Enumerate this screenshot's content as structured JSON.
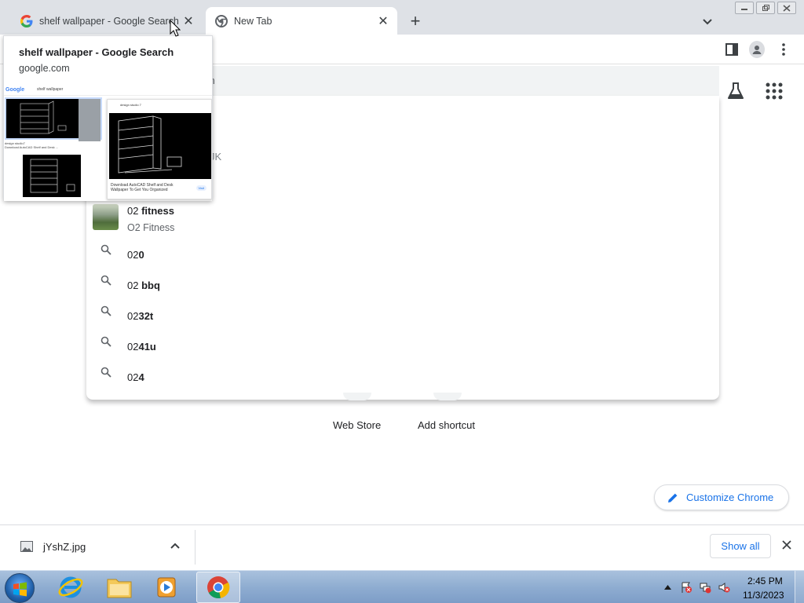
{
  "browser": {
    "tabs": [
      {
        "title": "shelf wallpaper - Google Search",
        "active": false,
        "favicon": "google-g-icon"
      },
      {
        "title": "New Tab",
        "active": true,
        "favicon": "chrome-icon"
      }
    ],
    "new_tab_glyph": "+",
    "tab_close_glyph": "✕"
  },
  "hover_card": {
    "title": "shelf wallpaper - Google Search",
    "domain": "google.com",
    "preview": {
      "logo": "Google",
      "query": "shelf wallpaper",
      "caption_line1": "design studio7",
      "caption_line2": "Download AutoCAD Shelf and Desk ...",
      "panel_source": "design studio 7",
      "panel_text": "Download AutoCAD Shelf and Desk Wallpaper To Get You Organized",
      "panel_visit": "Visit"
    }
  },
  "omnibox": {
    "placeholder_partial": "ch",
    "partial_text_uk": "JK"
  },
  "suggestions": [
    {
      "type": "entity",
      "prefix": "02 ",
      "bold": "fitness",
      "subtitle": "O2 Fitness",
      "icon": "thumbnail"
    },
    {
      "type": "search",
      "prefix": "02",
      "bold": "0",
      "icon": "search-icon"
    },
    {
      "type": "search",
      "prefix": "02 ",
      "bold": "bbq",
      "icon": "search-icon"
    },
    {
      "type": "search",
      "prefix": "02",
      "bold": "32t",
      "icon": "search-icon"
    },
    {
      "type": "search",
      "prefix": "02",
      "bold": "41u",
      "icon": "search-icon"
    },
    {
      "type": "search",
      "prefix": "02",
      "bold": "4",
      "icon": "search-icon"
    }
  ],
  "shortcuts": [
    {
      "label": "Web Store"
    },
    {
      "label": "Add shortcut"
    }
  ],
  "customize_button": "Customize Chrome",
  "download_shelf": {
    "file_name": "jYshZ.jpg",
    "show_all": "Show all"
  },
  "taskbar": {
    "time": "2:45 PM",
    "date": "11/3/2023",
    "apps": [
      "internet-explorer",
      "file-explorer",
      "media-player",
      "chrome"
    ]
  },
  "colors": {
    "accent": "#1a73e8",
    "tabstrip": "#dee1e6",
    "taskbar": "#8fadd1"
  }
}
